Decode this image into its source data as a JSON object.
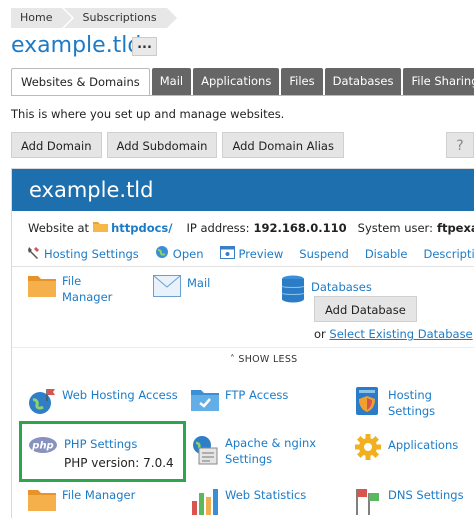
{
  "breadcrumb": [
    "Home",
    "Subscriptions"
  ],
  "page": {
    "title": "example.tld",
    "more_label": "..."
  },
  "tabs": [
    "Websites & Domains",
    "Mail",
    "Applications",
    "Files",
    "Databases",
    "File Sharing"
  ],
  "intro": "This is where you set up and manage websites.",
  "actions": [
    "Add Domain",
    "Add Subdomain",
    "Add Domain Alias"
  ],
  "help": "?",
  "domain": {
    "name": "example.tld",
    "website_at_label": "Website at",
    "docroot": "httpdocs/",
    "ip_label": "IP address:",
    "ip": "192.168.0.110",
    "user_label": "System user:",
    "user": "ftpexa",
    "links": [
      "Hosting Settings",
      "Open",
      "Preview",
      "Suspend",
      "Disable",
      "Description"
    ]
  },
  "tiles": {
    "file_manager": {
      "line1": "File",
      "line2": "Manager"
    },
    "mail": "Mail",
    "databases": "Databases",
    "add_database": "Add Database",
    "or": "or",
    "select_db": "Select Existing Database",
    "show_less": "SHOW LESS",
    "web_hosting_access": "Web Hosting Access",
    "ftp_access": "FTP Access",
    "hosting_settings": "Hosting Settings",
    "php_settings": "PHP Settings",
    "php_version": "PHP version: 7.0.4",
    "apache_nginx": {
      "line1": "Apache & nginx",
      "line2": "Settings"
    },
    "applications": "Applications",
    "file_manager2": "File Manager",
    "web_statistics": "Web Statistics",
    "dns_settings": "DNS Settings"
  },
  "colors": {
    "accent": "#1c7bc7",
    "header": "#1d6fad",
    "highlight": "#2ea44f"
  }
}
